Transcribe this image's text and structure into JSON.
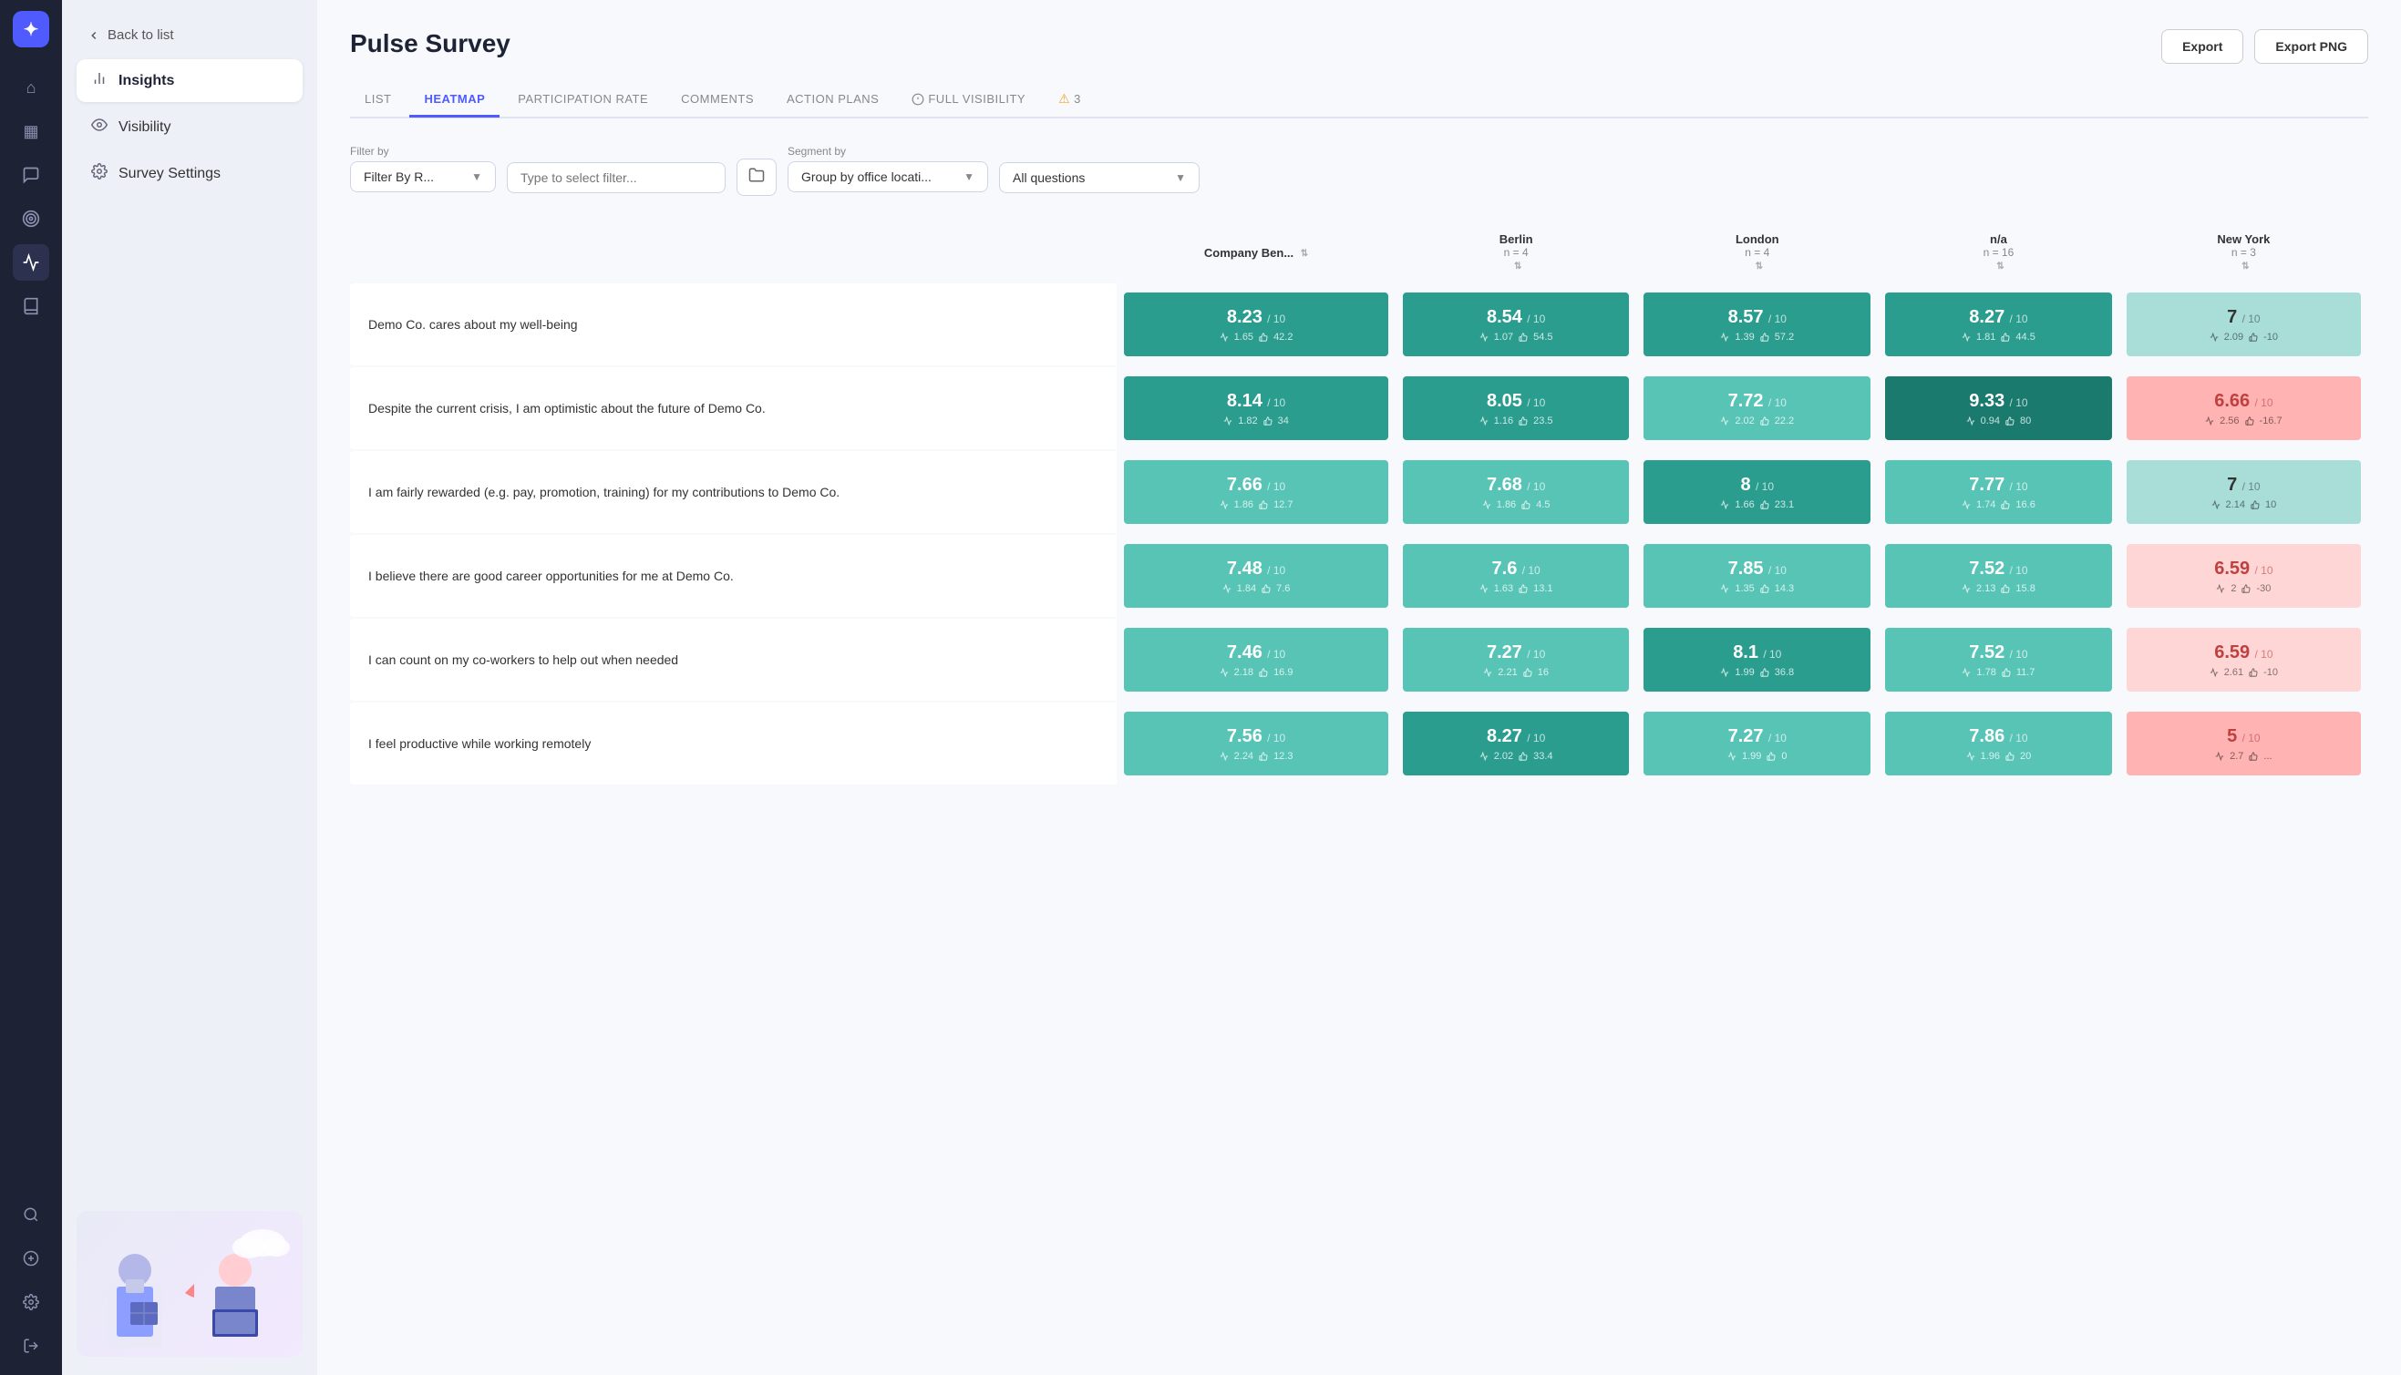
{
  "app": {
    "logo": "✦",
    "title": "Pulse Survey"
  },
  "nav_icons": [
    {
      "name": "home-icon",
      "glyph": "⌂",
      "active": false
    },
    {
      "name": "calendar-icon",
      "glyph": "▦",
      "active": false
    },
    {
      "name": "chat-icon",
      "glyph": "💬",
      "active": false
    },
    {
      "name": "target-icon",
      "glyph": "◎",
      "active": false
    },
    {
      "name": "pulse-icon",
      "glyph": "⚡",
      "active": true
    },
    {
      "name": "book-icon",
      "glyph": "📖",
      "active": false
    }
  ],
  "nav_bottom_icons": [
    {
      "name": "search-icon",
      "glyph": "🔍"
    },
    {
      "name": "add-icon",
      "glyph": "+"
    },
    {
      "name": "settings-icon",
      "glyph": "⚙"
    },
    {
      "name": "logout-icon",
      "glyph": "→"
    }
  ],
  "sidebar": {
    "back_label": "Back to list",
    "items": [
      {
        "id": "insights",
        "label": "Insights",
        "icon": "📊",
        "active": true
      },
      {
        "id": "visibility",
        "label": "Visibility",
        "icon": "👁",
        "active": false
      },
      {
        "id": "survey-settings",
        "label": "Survey Settings",
        "icon": "⚙",
        "active": false
      }
    ]
  },
  "tabs": [
    {
      "id": "list",
      "label": "LIST",
      "active": false
    },
    {
      "id": "heatmap",
      "label": "HEATMAP",
      "active": true
    },
    {
      "id": "participation-rate",
      "label": "PARTICIPATION RATE",
      "active": false
    },
    {
      "id": "comments",
      "label": "COMMENTS",
      "active": false
    },
    {
      "id": "action-plans",
      "label": "ACTION PLANS",
      "active": false
    },
    {
      "id": "full-visibility",
      "label": "FULL VISIBILITY",
      "active": false,
      "icon": "ⓘ"
    },
    {
      "id": "warning",
      "label": "3",
      "active": false,
      "icon": "⚠"
    }
  ],
  "buttons": {
    "export": "Export",
    "export_png": "Export PNG"
  },
  "filters": {
    "filter_by_label": "Filter by",
    "filter_by_placeholder": "Filter By R...",
    "type_filter_placeholder": "Type to select filter...",
    "segment_by_label": "Segment by",
    "segment_by_placeholder": "Group by office locati...",
    "all_questions_placeholder": "All questions"
  },
  "table": {
    "columns": [
      {
        "id": "company",
        "main": "Company Ben...",
        "sub": ""
      },
      {
        "id": "berlin",
        "main": "Berlin",
        "sub": "n = 4"
      },
      {
        "id": "london",
        "main": "London",
        "sub": "n = 4"
      },
      {
        "id": "na",
        "main": "n/a",
        "sub": "n = 16"
      },
      {
        "id": "newyork",
        "main": "New York",
        "sub": "n = 3"
      }
    ],
    "rows": [
      {
        "question": "Demo Co. cares about my well-being",
        "scores": [
          {
            "value": "8.23",
            "denom": "/ 10",
            "std": "1.65",
            "like": "42.2",
            "color": "c-green-mid"
          },
          {
            "value": "8.54",
            "denom": "/ 10",
            "std": "1.07",
            "like": "54.5",
            "color": "c-green-mid"
          },
          {
            "value": "8.57",
            "denom": "/ 10",
            "std": "1.39",
            "like": "57.2",
            "color": "c-green-mid"
          },
          {
            "value": "8.27",
            "denom": "/ 10",
            "std": "1.81",
            "like": "44.5",
            "color": "c-green-mid"
          },
          {
            "value": "7",
            "denom": "/ 10",
            "std": "2.09",
            "like": "-10",
            "color": "c-teal-light"
          }
        ]
      },
      {
        "question": "Despite the current crisis, I am optimistic about the future of Demo Co.",
        "scores": [
          {
            "value": "8.14",
            "denom": "/ 10",
            "std": "1.82",
            "like": "34",
            "color": "c-green-mid"
          },
          {
            "value": "8.05",
            "denom": "/ 10",
            "std": "1.16",
            "like": "23.5",
            "color": "c-green-mid"
          },
          {
            "value": "7.72",
            "denom": "/ 10",
            "std": "2.02",
            "like": "22.2",
            "color": "c-teal"
          },
          {
            "value": "9.33",
            "denom": "/ 10",
            "std": "0.94",
            "like": "80",
            "color": "c-green-dark"
          },
          {
            "value": "6.66",
            "denom": "/ 10",
            "std": "2.56",
            "like": "-16.7",
            "color": "c-pink"
          }
        ]
      },
      {
        "question": "I am fairly rewarded (e.g. pay, promotion, training) for my contributions to Demo Co.",
        "scores": [
          {
            "value": "7.66",
            "denom": "/ 10",
            "std": "1.86",
            "like": "12.7",
            "color": "c-teal"
          },
          {
            "value": "7.68",
            "denom": "/ 10",
            "std": "1.86",
            "like": "4.5",
            "color": "c-teal"
          },
          {
            "value": "8",
            "denom": "/ 10",
            "std": "1.66",
            "like": "23.1",
            "color": "c-green-mid"
          },
          {
            "value": "7.77",
            "denom": "/ 10",
            "std": "1.74",
            "like": "16.6",
            "color": "c-teal"
          },
          {
            "value": "7",
            "denom": "/ 10",
            "std": "2.14",
            "like": "10",
            "color": "c-teal-light"
          }
        ]
      },
      {
        "question": "I believe there are good career opportunities for me at Demo Co.",
        "scores": [
          {
            "value": "7.48",
            "denom": "/ 10",
            "std": "1.84",
            "like": "7.6",
            "color": "c-teal"
          },
          {
            "value": "7.6",
            "denom": "/ 10",
            "std": "1.63",
            "like": "13.1",
            "color": "c-teal"
          },
          {
            "value": "7.85",
            "denom": "/ 10",
            "std": "1.35",
            "like": "14.3",
            "color": "c-teal"
          },
          {
            "value": "7.52",
            "denom": "/ 10",
            "std": "2.13",
            "like": "15.8",
            "color": "c-teal"
          },
          {
            "value": "6.59",
            "denom": "/ 10",
            "std": "2",
            "like": "-30",
            "color": "c-pink-light"
          }
        ]
      },
      {
        "question": "I can count on my co-workers to help out when needed",
        "scores": [
          {
            "value": "7.46",
            "denom": "/ 10",
            "std": "2.18",
            "like": "16.9",
            "color": "c-teal"
          },
          {
            "value": "7.27",
            "denom": "/ 10",
            "std": "2.21",
            "like": "16",
            "color": "c-teal"
          },
          {
            "value": "8.1",
            "denom": "/ 10",
            "std": "1.99",
            "like": "36.8",
            "color": "c-green-mid"
          },
          {
            "value": "7.52",
            "denom": "/ 10",
            "std": "1.78",
            "like": "11.7",
            "color": "c-teal"
          },
          {
            "value": "6.59",
            "denom": "/ 10",
            "std": "2.61",
            "like": "-10",
            "color": "c-pink-light"
          }
        ]
      },
      {
        "question": "I feel productive while working remotely",
        "scores": [
          {
            "value": "7.56",
            "denom": "/ 10",
            "std": "2.24",
            "like": "12.3",
            "color": "c-teal"
          },
          {
            "value": "8.27",
            "denom": "/ 10",
            "std": "2.02",
            "like": "33.4",
            "color": "c-green-mid"
          },
          {
            "value": "7.27",
            "denom": "/ 10",
            "std": "1.99",
            "like": "0",
            "color": "c-teal"
          },
          {
            "value": "7.86",
            "denom": "/ 10",
            "std": "1.96",
            "like": "20",
            "color": "c-teal"
          },
          {
            "value": "5",
            "denom": "/ 10",
            "std": "2.7",
            "like": "...",
            "color": "c-pink"
          }
        ]
      }
    ]
  }
}
